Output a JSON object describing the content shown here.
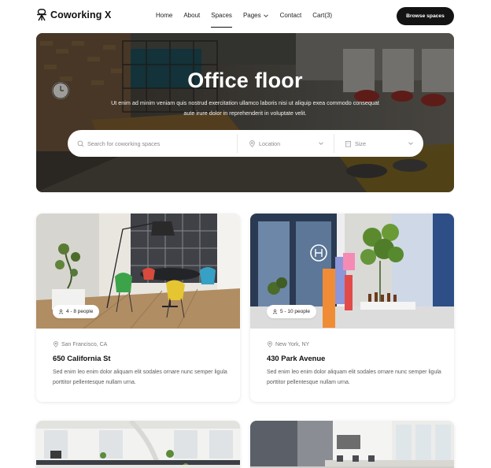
{
  "brand": {
    "name": "Coworking X",
    "logo_icon": "tripod-chair-icon"
  },
  "nav": {
    "items": [
      {
        "label": "Home"
      },
      {
        "label": "About"
      },
      {
        "label": "Spaces",
        "active": true
      },
      {
        "label": "Pages",
        "has_dropdown": true
      },
      {
        "label": "Contact"
      },
      {
        "label": "Cart(3)"
      }
    ],
    "cta_label": "Browse spaces"
  },
  "hero": {
    "title": "Office floor",
    "subtitle": "Ut enim ad minim veniam quis nostrud exercitation ullamco laboris nisi ut aliquip exea commodo consequat aute irure dolor in reprehenderit in voluptate velit.",
    "search": {
      "query_placeholder": "Search for coworking spaces",
      "location_placeholder": "Location",
      "size_placeholder": "Size"
    }
  },
  "listings": [
    {
      "capacity": "4 - 8 people",
      "location": "San Francisco, CA",
      "title": "650 California St",
      "description": "Sed enim leo enim dolor aliquam elit sodales ornare nunc semper ligula porttitor pellentesque nullam urna."
    },
    {
      "capacity": "5 - 10 people",
      "location": "New York, NY",
      "title": "430 Park Avenue",
      "description": "Sed enim leo enim dolor aliquam elit sodales ornare nunc semper ligula porttitor pellentesque nullam urna."
    }
  ],
  "colors": {
    "cta_bg": "#131313",
    "text_primary": "#111111",
    "text_muted": "#7a7a7a"
  }
}
